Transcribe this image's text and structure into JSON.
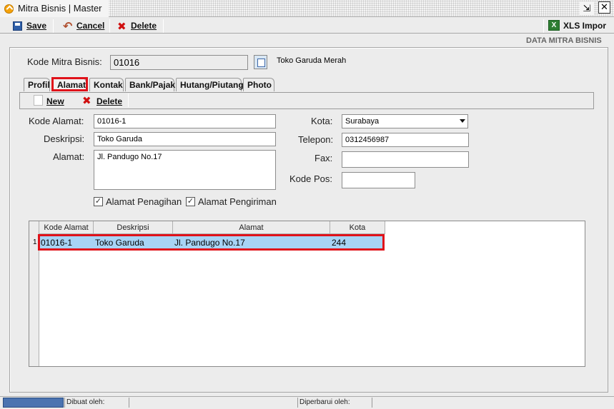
{
  "window": {
    "title": "Mitra Bisnis | Master",
    "restore_glyph": "⇲",
    "close_glyph": "✕"
  },
  "toolbar": {
    "save_label": "Save",
    "cancel_label": "Cancel",
    "delete_label": "Delete",
    "xls_label": "XLS Impor",
    "xls_icon_glyph": "X"
  },
  "header": {
    "section_label": "DATA MITRA BISNIS"
  },
  "kode_mitra": {
    "label": "Kode Mitra Bisnis:",
    "value": "01016",
    "name": "Toko Garuda Merah"
  },
  "tabs": [
    {
      "label": "Profil",
      "active": false
    },
    {
      "label": "Alamat",
      "active": true
    },
    {
      "label": "Kontak",
      "active": false
    },
    {
      "label": "Bank/Pajak",
      "active": false
    },
    {
      "label": "Hutang/Piutang",
      "active": false
    },
    {
      "label": "Photo",
      "active": false
    }
  ],
  "subtoolbar": {
    "new_label": "New",
    "delete_label": "Delete"
  },
  "form": {
    "kode_alamat": {
      "label": "Kode Alamat:",
      "value": "01016-1"
    },
    "deskripsi": {
      "label": "Deskripsi:",
      "value": "Toko Garuda"
    },
    "alamat": {
      "label": "Alamat:",
      "value": "Jl. Pandugo No.17"
    },
    "kota": {
      "label": "Kota:",
      "value": "Surabaya"
    },
    "telepon": {
      "label": "Telepon:",
      "value": "0312456987"
    },
    "fax": {
      "label": "Fax:",
      "value": ""
    },
    "kode_pos": {
      "label": "Kode Pos:",
      "value": ""
    },
    "alamat_penagihan": {
      "label": "Alamat Penagihan",
      "checked": true
    },
    "alamat_pengiriman": {
      "label": "Alamat Pengiriman",
      "checked": true
    },
    "check_glyph": "✓"
  },
  "grid": {
    "columns": [
      "Kode Alamat",
      "Deskripsi",
      "Alamat",
      "Kota"
    ],
    "rows": [
      {
        "num": "1",
        "kode_alamat": "01016-1",
        "deskripsi": "Toko Garuda",
        "alamat": "Jl. Pandugo No.17",
        "kota": "244"
      }
    ]
  },
  "status": {
    "created_by": "Dibuat oleh:",
    "updated_by": "Diperbarui oleh:"
  },
  "colors": {
    "highlight": "#e0121a",
    "row_selected": "#a8d4f5",
    "progress": "#4b73b0"
  },
  "icons": {
    "app": "app-logo-icon",
    "save": "floppy-icon",
    "cancel": "undo-arrow-icon",
    "delete": "red-x-icon",
    "xls": "excel-icon",
    "lookup": "lookup-icon",
    "new": "blank-page-icon"
  }
}
